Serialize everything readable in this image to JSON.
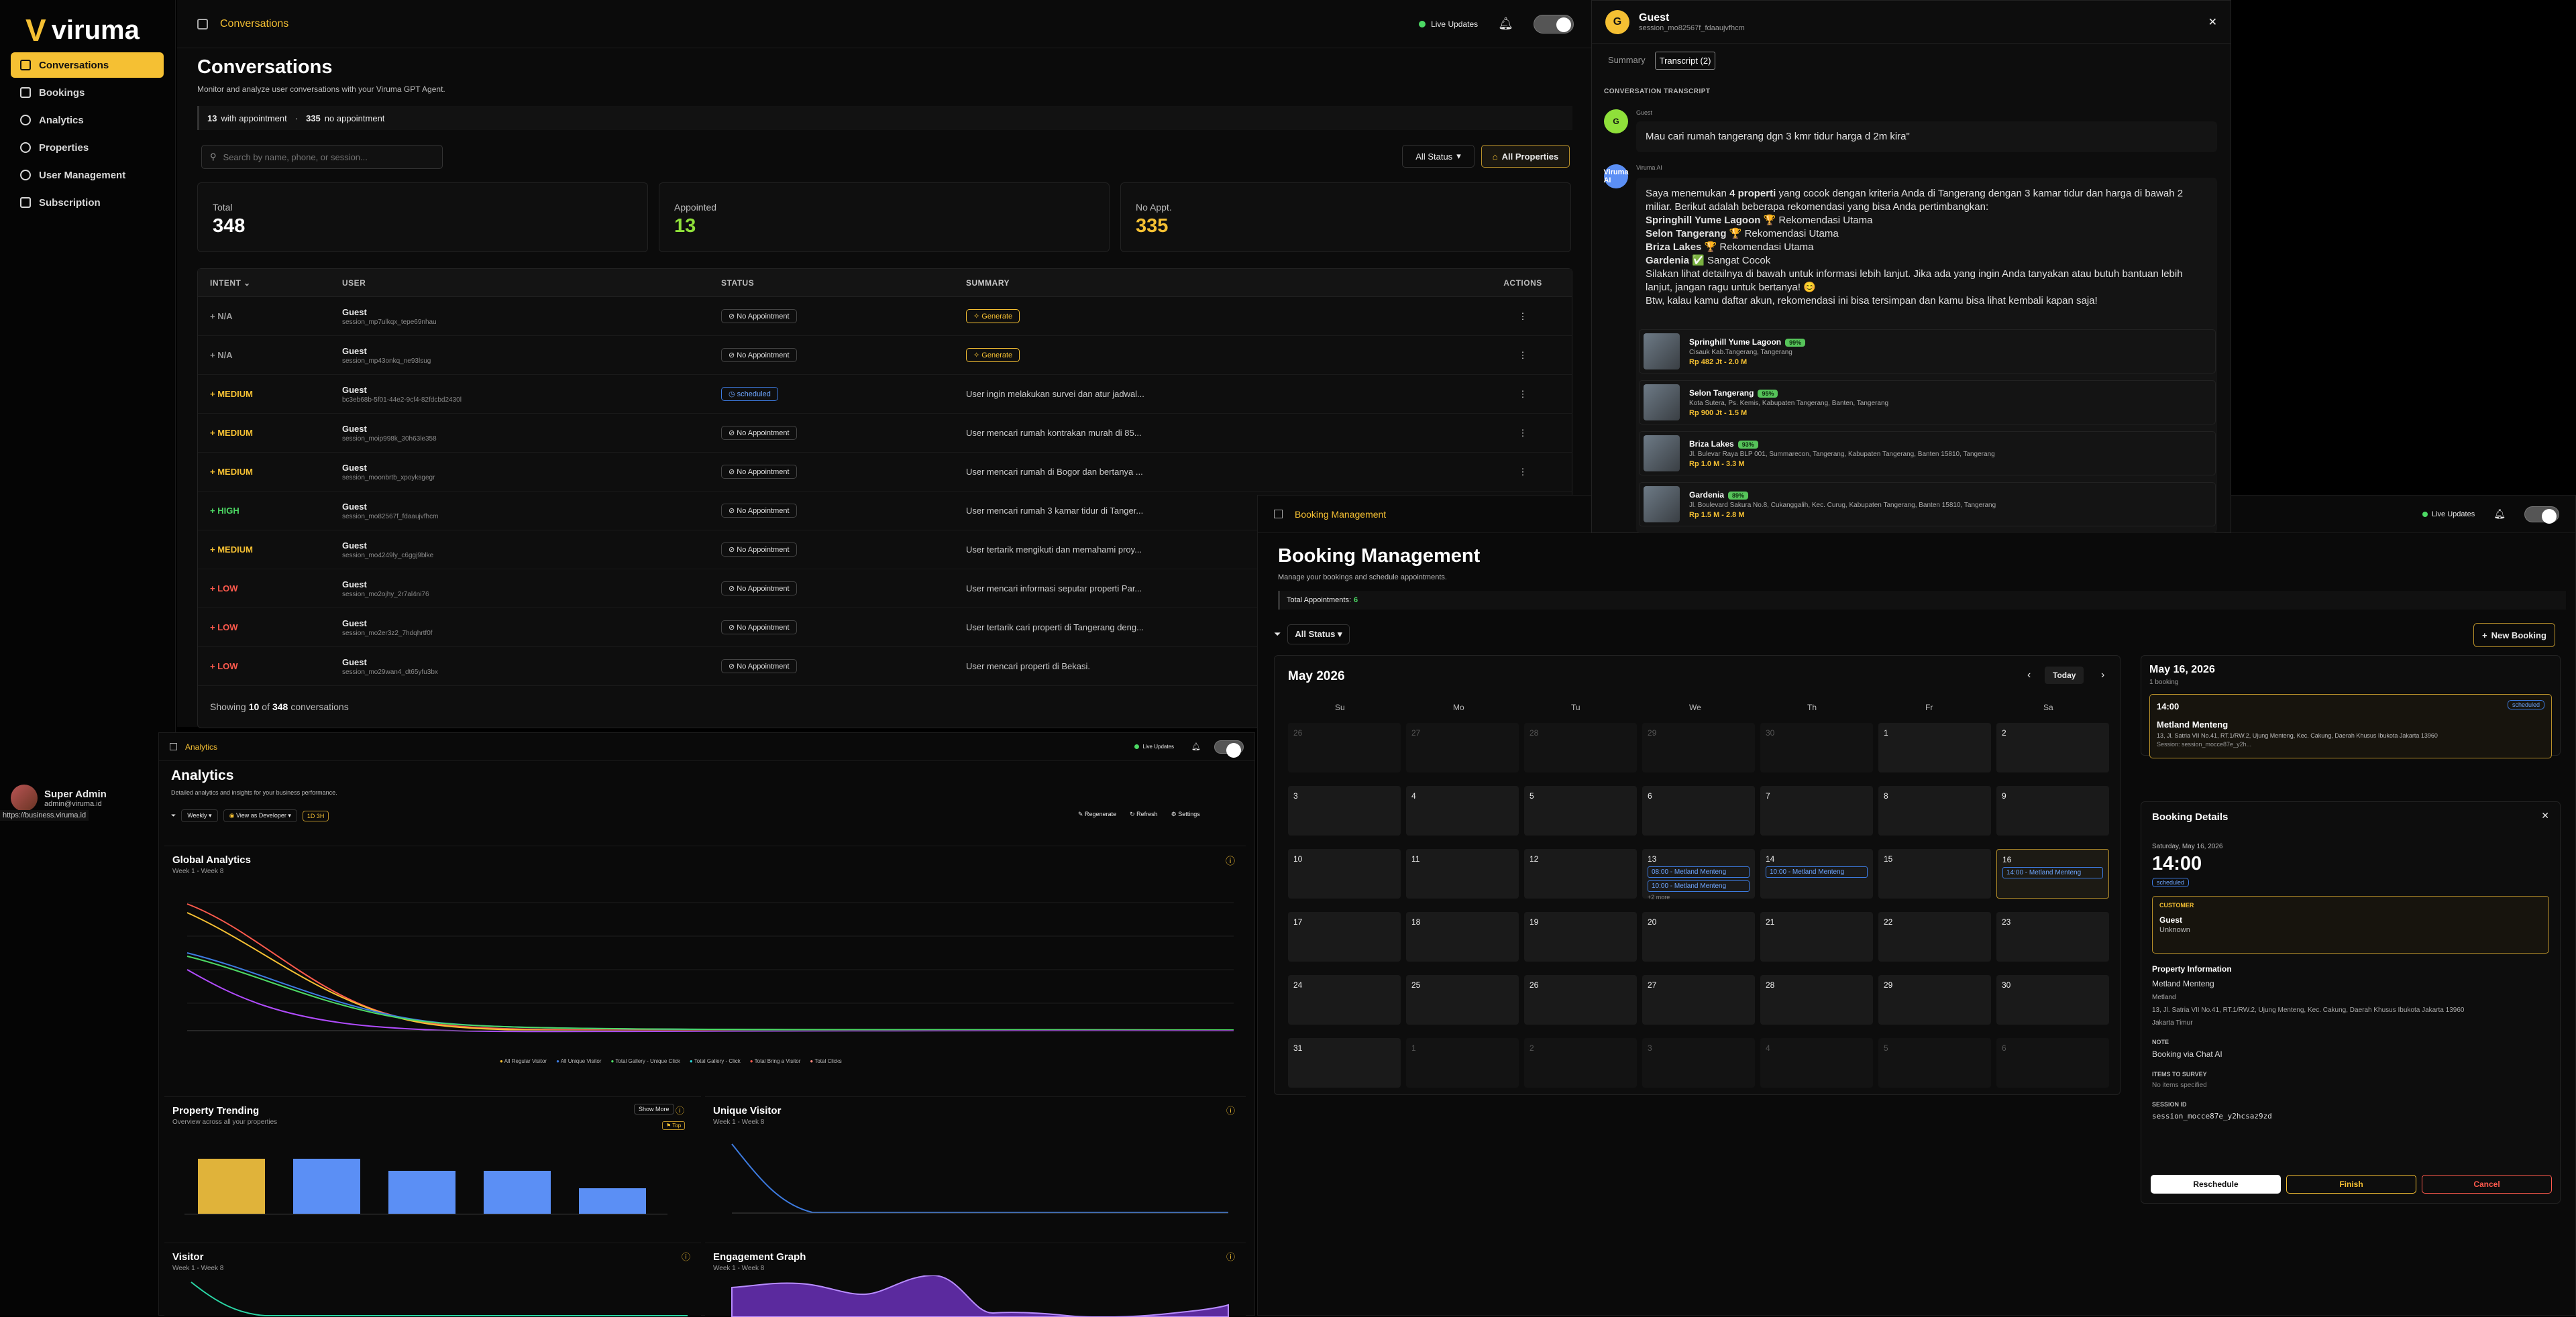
{
  "brand": {
    "name": "viruma"
  },
  "sidebar": {
    "items": [
      {
        "label": "Conversations"
      },
      {
        "label": "Bookings"
      },
      {
        "label": "Analytics"
      },
      {
        "label": "Properties"
      },
      {
        "label": "User Management"
      },
      {
        "label": "Subscription"
      }
    ],
    "user": {
      "name": "Super Admin",
      "email": "admin@viruma.id"
    },
    "url": "https://business.viruma.id"
  },
  "conversations": {
    "breadcrumb": "Conversations",
    "live": "Live Updates",
    "title": "Conversations",
    "subtitle": "Monitor and analyze user conversations with your Viruma GPT Agent.",
    "appt_count": "13",
    "appt_label": "with appointment",
    "noappt_count": "335",
    "noappt_label": "no appointment",
    "search_placeholder": "Search by name, phone, or session...",
    "status_filter": "All Status",
    "property_filter": "All Properties",
    "stats": [
      {
        "label": "Total",
        "value": "348"
      },
      {
        "label": "Appointed",
        "value": "13"
      },
      {
        "label": "No Appt.",
        "value": "335"
      }
    ],
    "headers": [
      "INTENT",
      "USER",
      "STATUS",
      "SUMMARY",
      "ACTIONS"
    ],
    "rows": [
      {
        "intent": "N/A",
        "user": "Guest",
        "session": "session_mp7ulkqx_tepe69nhau",
        "status": "No Appointment",
        "summary": "Generate",
        "gen": true,
        "color": "#9a9a9a"
      },
      {
        "intent": "N/A",
        "user": "Guest",
        "session": "session_mp43onkq_ne93lsug",
        "status": "No Appointment",
        "summary": "Generate",
        "gen": true,
        "color": "#9a9a9a"
      },
      {
        "intent": "MEDIUM",
        "user": "Guest",
        "session": "bc3eb68b-5f01-44e2-9cf4-82fdcbd2430l",
        "status": "scheduled",
        "summary": "User ingin melakukan survei dan atur jadwal...",
        "gen": false,
        "color": "#f5c033"
      },
      {
        "intent": "MEDIUM",
        "user": "Guest",
        "session": "session_moip998k_30h63le358",
        "status": "No Appointment",
        "summary": "User mencari rumah kontrakan murah di 85...",
        "gen": false,
        "color": "#f5c033"
      },
      {
        "intent": "MEDIUM",
        "user": "Guest",
        "session": "session_moonbrtb_xpoyksgegr",
        "status": "No Appointment",
        "summary": "User mencari rumah di Bogor dan bertanya ...",
        "gen": false,
        "color": "#f5c033"
      },
      {
        "intent": "HIGH",
        "user": "Guest",
        "session": "session_mo82567f_fdaaujvfhcm",
        "status": "No Appointment",
        "summary": "User mencari rumah 3 kamar tidur di Tanger...",
        "gen": false,
        "color": "#4cd964"
      },
      {
        "intent": "MEDIUM",
        "user": "Guest",
        "session": "session_mo4249ly_c6ggj9blke",
        "status": "No Appointment",
        "summary": "User tertarik mengikuti dan memahami proy...",
        "gen": false,
        "color": "#f5c033"
      },
      {
        "intent": "LOW",
        "user": "Guest",
        "session": "session_mo2ojhy_2r7al4ni76",
        "status": "No Appointment",
        "summary": "User mencari informasi seputar properti Par...",
        "gen": false,
        "color": "#ff5a4d"
      },
      {
        "intent": "LOW",
        "user": "Guest",
        "session": "session_mo2er3z2_7hdqhrtf0f",
        "status": "No Appointment",
        "summary": "User tertarik cari properti di Tangerang deng...",
        "gen": false,
        "color": "#ff5a4d"
      },
      {
        "intent": "LOW",
        "user": "Guest",
        "session": "session_mo29wan4_dt65yfu3bx",
        "status": "No Appointment",
        "summary": "User mencari properti di Bekasi.",
        "gen": false,
        "color": "#ff5a4d"
      }
    ],
    "footer_pre": "Showing",
    "footer_shown": "10",
    "footer_mid": "of",
    "footer_total": "348",
    "footer_post": "conversations"
  },
  "analytics": {
    "breadcrumb": "Analytics",
    "live": "Live Updates",
    "title": "Analytics",
    "subtitle": "Detailed analytics and insights for your business performance.",
    "period": "Weekly",
    "view_as": "View as Developer",
    "badge": "1D 3H",
    "actions": [
      "Regenerate",
      "Refresh",
      "Settings"
    ],
    "global": {
      "title": "Global Analytics",
      "sub": "Week 1 - Week 8",
      "legend": [
        "All Regular Visitor",
        "All Unique Visitor",
        "Total Gallery - Unique Click",
        "Total Gallery - Click",
        "Total Bring a Visitor",
        "Total Clicks"
      ]
    },
    "trending": {
      "title": "Property Trending",
      "sub": "Overview across all your properties",
      "show_more": "Show More",
      "top": "Top"
    },
    "unique": {
      "title": "Unique Visitor",
      "sub": "Week 1 - Week 8"
    },
    "visitor": {
      "title": "Visitor",
      "sub": "Week 1 - Week 8"
    },
    "engagement": {
      "title": "Engagement Graph",
      "sub": "Week 1 - Week 8"
    }
  },
  "transcript": {
    "name": "Guest",
    "session": "session_mo82567f_fdaaujvfhcm",
    "avatar": "G",
    "tabs": [
      "Summary",
      "Transcript (2)"
    ],
    "section": "CONVERSATION TRANSCRIPT",
    "guest_label": "Guest",
    "guest_msg": "Mau cari rumah tangerang dgn 3 kmr tidur harga d 2m kira\"",
    "ai_label": "Viruma AI",
    "ai_avatar": "AI",
    "ai_p1a": "Saya menemukan",
    "ai_p1b": "4 properti",
    "ai_p1c": "yang cocok dengan kriteria Anda di Tangerang dengan 3 kamar tidur dan harga di bawah 2 miliar. Berikut adalah beberapa rekomendasi yang bisa Anda pertimbangkan:",
    "recs": [
      {
        "name": "Springhill Yume Lagoon",
        "note": "🏆 Rekomendasi Utama"
      },
      {
        "name": "Selon Tangerang",
        "note": "🏆 Rekomendasi Utama"
      },
      {
        "name": "Briza Lakes",
        "note": "🏆 Rekomendasi Utama"
      },
      {
        "name": "Gardenia",
        "note": "✅ Sangat Cocok"
      }
    ],
    "ai_p2": "Silakan lihat detailnya di bawah untuk informasi lebih lanjut. Jika ada yang ingin Anda tanyakan atau butuh bantuan lebih lanjut, jangan ragu untuk bertanya! 😊",
    "ai_p3": "Btw, kalau kamu daftar akun, rekomendasi ini bisa tersimpan dan kamu bisa lihat kembali kapan saja!",
    "props": [
      {
        "name": "Springhill Yume Lagoon",
        "tag": "99%",
        "addr": "Cisauk Kab.Tangerang, Tangerang",
        "price": "Rp 482 Jt - 2.0 M"
      },
      {
        "name": "Selon Tangerang",
        "tag": "95%",
        "addr": "Kota Sutera, Ps. Kemis, Kabupaten Tangerang, Banten, Tangerang",
        "price": "Rp 900 Jt - 1.5 M"
      },
      {
        "name": "Briza Lakes",
        "tag": "93%",
        "addr": "Jl. Bulevar Raya BLP 001, Summarecon, Tangerang, Kabupaten Tangerang, Banten 15810, Tangerang",
        "price": "Rp 1.0 M - 3.3 M"
      },
      {
        "name": "Gardenia",
        "tag": "89%",
        "addr": "Jl. Boulevard Sakura No.8, Cukanggalih, Kec. Curug, Kabupaten Tangerang, Banten 15810, Tangerang",
        "price": "Rp 1.5 M - 2.8 M"
      }
    ]
  },
  "booking": {
    "breadcrumb": "Booking Management",
    "live": "Live Updates",
    "title": "Booking Management",
    "subtitle": "Manage your bookings and schedule appointments.",
    "total_label": "Total Appointments:",
    "total_value": "6",
    "status_filter": "All Status",
    "new_booking": "New Booking",
    "month": "May 2026",
    "today": "Today",
    "weekdays": [
      "Su",
      "Mo",
      "Tu",
      "We",
      "Th",
      "Fr",
      "Sa"
    ],
    "weeks": [
      [
        {
          "d": "26",
          "m": false
        },
        {
          "d": "27",
          "m": false
        },
        {
          "d": "28",
          "m": false
        },
        {
          "d": "29",
          "m": false
        },
        {
          "d": "30",
          "m": false
        },
        {
          "d": "1",
          "m": true
        },
        {
          "d": "2",
          "m": true
        }
      ],
      [
        {
          "d": "3",
          "m": true
        },
        {
          "d": "4",
          "m": true
        },
        {
          "d": "5",
          "m": true
        },
        {
          "d": "6",
          "m": true
        },
        {
          "d": "7",
          "m": true
        },
        {
          "d": "8",
          "m": true
        },
        {
          "d": "9",
          "m": true
        }
      ],
      [
        {
          "d": "10",
          "m": true
        },
        {
          "d": "11",
          "m": true
        },
        {
          "d": "12",
          "m": true
        },
        {
          "d": "13",
          "m": true,
          "events": [
            "08:00 - Metland Menteng",
            "10:00 - Metland Menteng"
          ],
          "more": "+2 more"
        },
        {
          "d": "14",
          "m": true,
          "events": [
            "10:00 - Metland Menteng"
          ]
        },
        {
          "d": "15",
          "m": true
        },
        {
          "d": "16",
          "m": true,
          "sel": true,
          "events": [
            "14:00 - Metland Menteng"
          ]
        }
      ],
      [
        {
          "d": "17",
          "m": true
        },
        {
          "d": "18",
          "m": true
        },
        {
          "d": "19",
          "m": true
        },
        {
          "d": "20",
          "m": true
        },
        {
          "d": "21",
          "m": true
        },
        {
          "d": "22",
          "m": true
        },
        {
          "d": "23",
          "m": true
        }
      ],
      [
        {
          "d": "24",
          "m": true
        },
        {
          "d": "25",
          "m": true
        },
        {
          "d": "26",
          "m": true
        },
        {
          "d": "27",
          "m": true
        },
        {
          "d": "28",
          "m": true
        },
        {
          "d": "29",
          "m": true
        },
        {
          "d": "30",
          "m": true
        }
      ],
      [
        {
          "d": "31",
          "m": true
        },
        {
          "d": "1",
          "m": false
        },
        {
          "d": "2",
          "m": false
        },
        {
          "d": "3",
          "m": false
        },
        {
          "d": "4",
          "m": false
        },
        {
          "d": "5",
          "m": false
        },
        {
          "d": "6",
          "m": false
        }
      ]
    ],
    "day_title": "May 16, 2026",
    "day_count": "1 booking",
    "slot": {
      "time": "14:00",
      "status": "scheduled",
      "place": "Metland Menteng",
      "addr": "13, Jl. Satria VII No.41, RT.1/RW.2, Ujung Menteng, Kec. Cakung, Daerah Khusus Ibukota Jakarta 13960",
      "session": "Session: session_mocce87e_y2h..."
    },
    "details": {
      "title": "Booking Details",
      "date": "Saturday, May 16, 2026",
      "time": "14:00",
      "status": "scheduled",
      "customer_label": "CUSTOMER",
      "customer_name": "Guest",
      "customer_phone": "Unknown",
      "prop_label": "Property Information",
      "prop_name": "Metland Menteng",
      "prop_sub": "Metland",
      "prop_addr": "13, Jl. Satria VII No.41, RT.1/RW.2, Ujung Menteng, Kec. Cakung, Daerah Khusus Ibukota Jakarta 13960",
      "prop_city": "Jakarta Timur",
      "note_label": "NOTE",
      "note": "Booking via Chat AI",
      "items_label": "ITEMS TO SURVEY",
      "items": "No items specified",
      "session_label": "SESSION ID",
      "session": "session_mocce87e_y2hcsaz9zd",
      "buttons": [
        "Reschedule",
        "Finish",
        "Cancel"
      ]
    }
  }
}
